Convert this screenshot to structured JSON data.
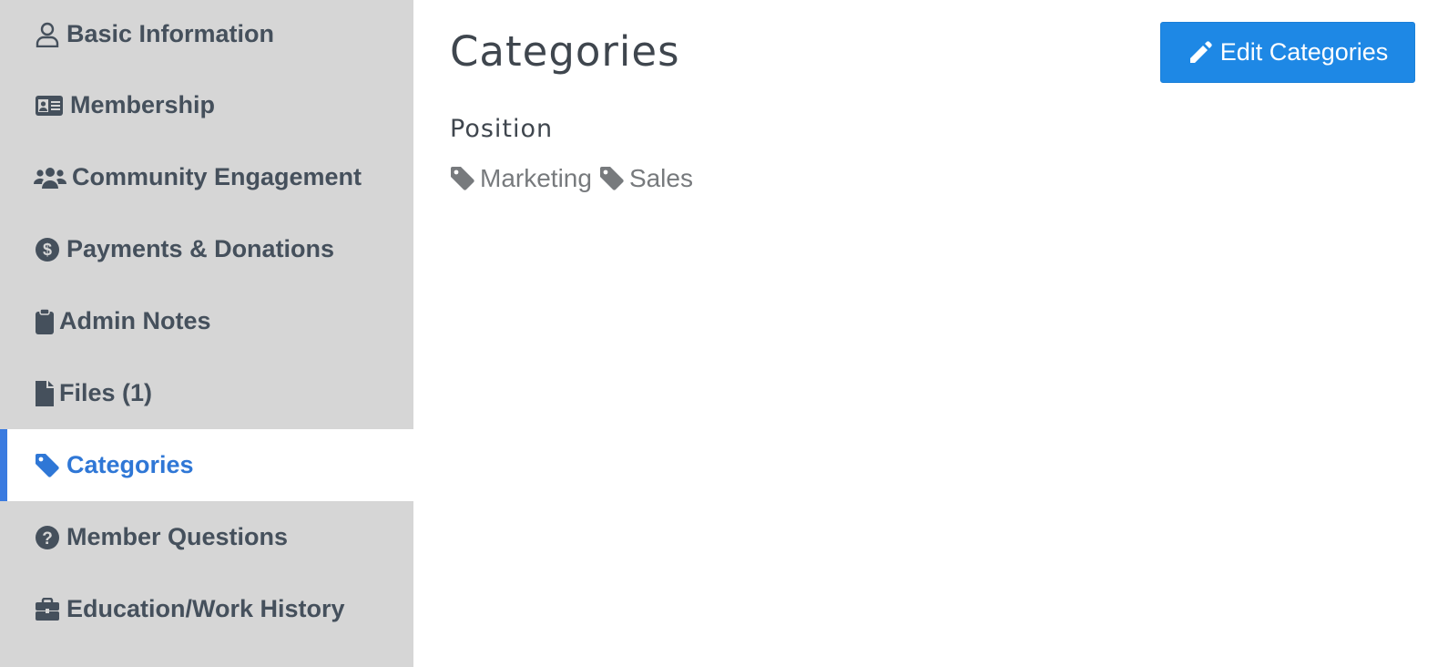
{
  "sidebar": {
    "items": [
      {
        "label": "Basic Information",
        "icon": "user-icon"
      },
      {
        "label": "Membership",
        "icon": "id-card-icon"
      },
      {
        "label": "Community Engagement",
        "icon": "users-icon"
      },
      {
        "label": "Payments & Donations",
        "icon": "dollar-circle-icon"
      },
      {
        "label": "Admin Notes",
        "icon": "clipboard-icon"
      },
      {
        "label": "Files (1)",
        "icon": "file-icon"
      },
      {
        "label": "Categories",
        "icon": "tag-icon"
      },
      {
        "label": "Member Questions",
        "icon": "question-circle-icon"
      },
      {
        "label": "Education/Work History",
        "icon": "briefcase-icon"
      }
    ],
    "active_index": 6
  },
  "main": {
    "title": "Categories",
    "edit_button_label": "Edit Categories",
    "edit_button_icon": "pencil-icon",
    "section_label": "Position",
    "tags": [
      {
        "label": "Marketing",
        "icon": "tag-icon"
      },
      {
        "label": "Sales",
        "icon": "tag-icon"
      }
    ]
  },
  "colors": {
    "sidebar_bg": "#d6d6d6",
    "sidebar_text": "#45505c",
    "active_text": "#2f77d6",
    "active_bar": "#3a7be0",
    "button_bg": "#1e88e5",
    "tag_text": "#777a7d"
  }
}
